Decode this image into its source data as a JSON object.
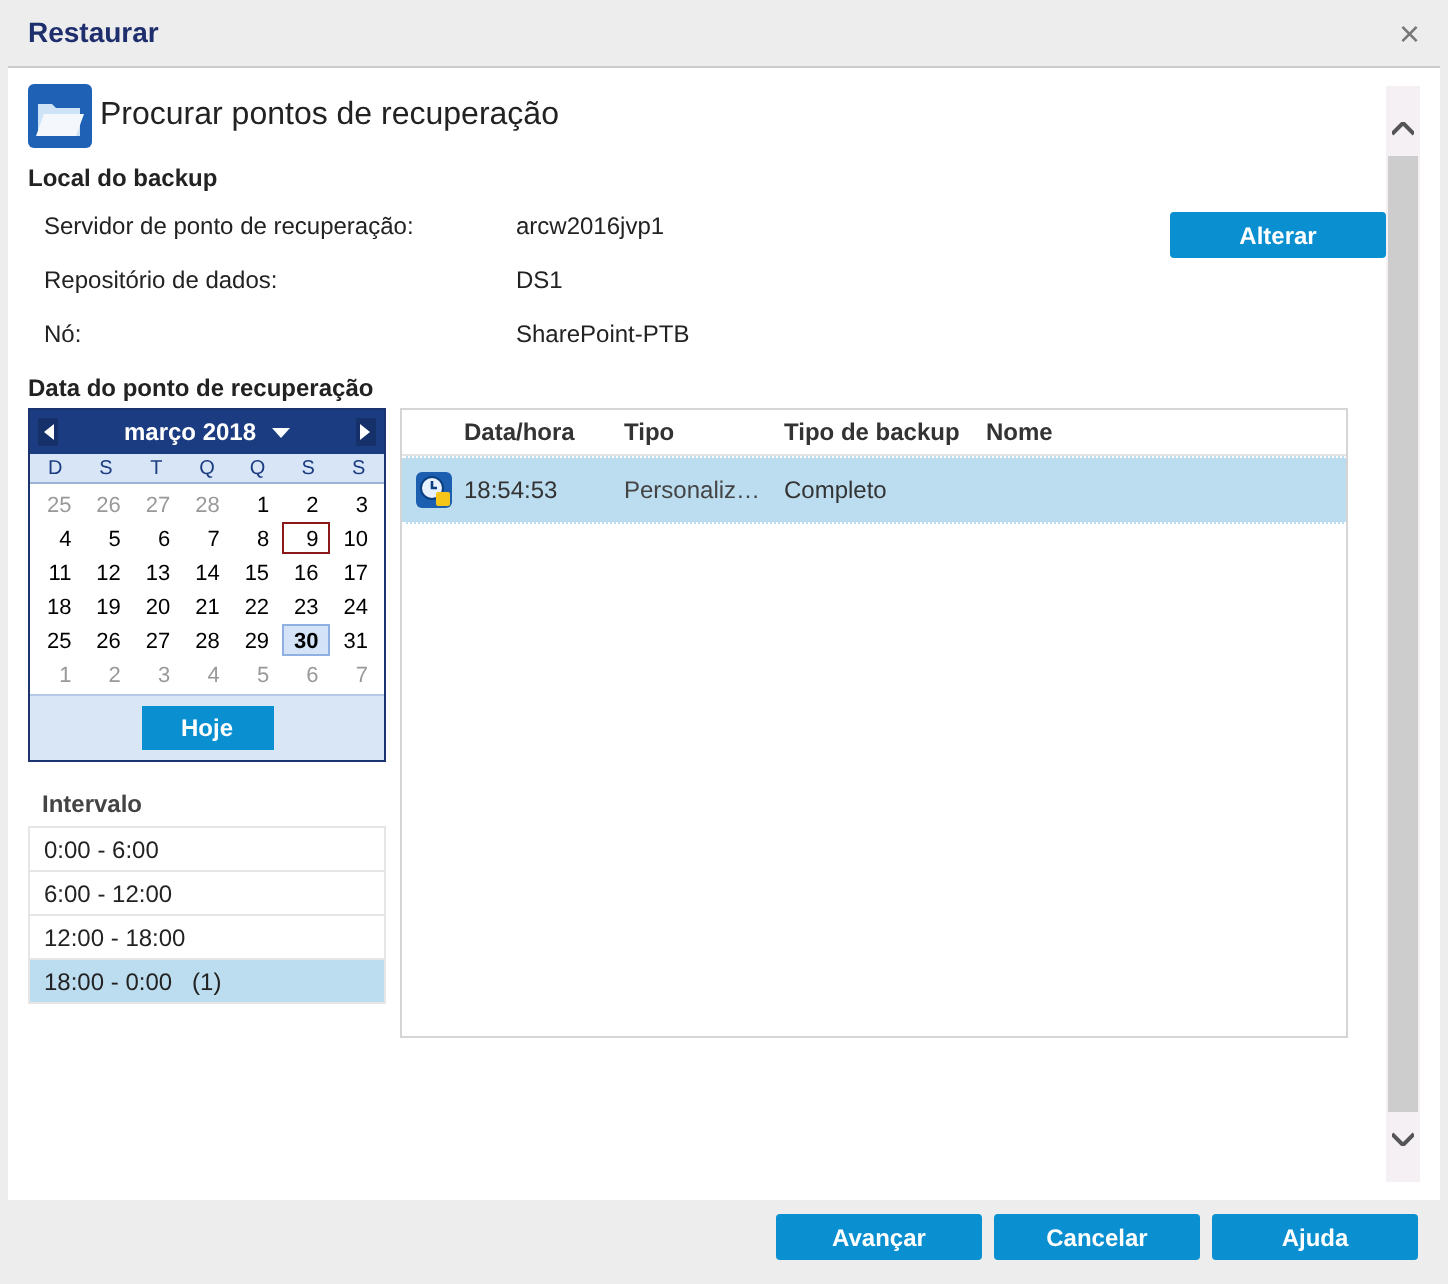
{
  "window": {
    "title": "Restaurar",
    "close": "×"
  },
  "header": {
    "title": "Procurar pontos de recuperação"
  },
  "backup_location": {
    "title": "Local do backup",
    "fields": [
      {
        "label": "Servidor de ponto de recuperação:",
        "value": "arcw2016jvp1"
      },
      {
        "label": "Repositório de dados:",
        "value": "DS1"
      },
      {
        "label": "Nó:",
        "value": "SharePoint-PTB"
      }
    ],
    "change_button": "Alterar"
  },
  "date_section": {
    "title": "Data do ponto de recuperação"
  },
  "calendar": {
    "month": "março 2018",
    "weekdays": [
      "D",
      "S",
      "T",
      "Q",
      "Q",
      "S",
      "S"
    ],
    "today_button": "Hoje",
    "days": [
      {
        "d": "25",
        "muted": true,
        "selected": false,
        "boxed": false
      },
      {
        "d": "26",
        "muted": true,
        "selected": false,
        "boxed": false
      },
      {
        "d": "27",
        "muted": true,
        "selected": false,
        "boxed": false
      },
      {
        "d": "28",
        "muted": true,
        "selected": false,
        "boxed": false
      },
      {
        "d": "1",
        "muted": false,
        "selected": false,
        "boxed": false
      },
      {
        "d": "2",
        "muted": false,
        "selected": false,
        "boxed": false
      },
      {
        "d": "3",
        "muted": false,
        "selected": false,
        "boxed": false
      },
      {
        "d": "4",
        "muted": false,
        "selected": false,
        "boxed": false
      },
      {
        "d": "5",
        "muted": false,
        "selected": false,
        "boxed": false
      },
      {
        "d": "6",
        "muted": false,
        "selected": false,
        "boxed": false
      },
      {
        "d": "7",
        "muted": false,
        "selected": false,
        "boxed": false
      },
      {
        "d": "8",
        "muted": false,
        "selected": false,
        "boxed": false
      },
      {
        "d": "9",
        "muted": false,
        "selected": false,
        "boxed": true
      },
      {
        "d": "10",
        "muted": false,
        "selected": false,
        "boxed": false
      },
      {
        "d": "11",
        "muted": false,
        "selected": false,
        "boxed": false
      },
      {
        "d": "12",
        "muted": false,
        "selected": false,
        "boxed": false
      },
      {
        "d": "13",
        "muted": false,
        "selected": false,
        "boxed": false
      },
      {
        "d": "14",
        "muted": false,
        "selected": false,
        "boxed": false
      },
      {
        "d": "15",
        "muted": false,
        "selected": false,
        "boxed": false
      },
      {
        "d": "16",
        "muted": false,
        "selected": false,
        "boxed": false
      },
      {
        "d": "17",
        "muted": false,
        "selected": false,
        "boxed": false
      },
      {
        "d": "18",
        "muted": false,
        "selected": false,
        "boxed": false
      },
      {
        "d": "19",
        "muted": false,
        "selected": false,
        "boxed": false
      },
      {
        "d": "20",
        "muted": false,
        "selected": false,
        "boxed": false
      },
      {
        "d": "21",
        "muted": false,
        "selected": false,
        "boxed": false
      },
      {
        "d": "22",
        "muted": false,
        "selected": false,
        "boxed": false
      },
      {
        "d": "23",
        "muted": false,
        "selected": false,
        "boxed": false
      },
      {
        "d": "24",
        "muted": false,
        "selected": false,
        "boxed": false
      },
      {
        "d": "25",
        "muted": false,
        "selected": false,
        "boxed": false
      },
      {
        "d": "26",
        "muted": false,
        "selected": false,
        "boxed": false
      },
      {
        "d": "27",
        "muted": false,
        "selected": false,
        "boxed": false
      },
      {
        "d": "28",
        "muted": false,
        "selected": false,
        "boxed": false
      },
      {
        "d": "29",
        "muted": false,
        "selected": false,
        "boxed": false
      },
      {
        "d": "30",
        "muted": false,
        "selected": true,
        "boxed": false
      },
      {
        "d": "31",
        "muted": false,
        "selected": false,
        "boxed": false
      },
      {
        "d": "1",
        "muted": true,
        "selected": false,
        "boxed": false
      },
      {
        "d": "2",
        "muted": true,
        "selected": false,
        "boxed": false
      },
      {
        "d": "3",
        "muted": true,
        "selected": false,
        "boxed": false
      },
      {
        "d": "4",
        "muted": true,
        "selected": false,
        "boxed": false
      },
      {
        "d": "5",
        "muted": true,
        "selected": false,
        "boxed": false
      },
      {
        "d": "6",
        "muted": true,
        "selected": false,
        "boxed": false
      },
      {
        "d": "7",
        "muted": true,
        "selected": false,
        "boxed": false
      }
    ]
  },
  "intervals": {
    "title": "Intervalo",
    "items": [
      {
        "label": "0:00 - 6:00",
        "selected": false
      },
      {
        "label": "6:00 - 12:00",
        "selected": false
      },
      {
        "label": "12:00 - 18:00",
        "selected": false
      },
      {
        "label": "18:00 - 0:00   (1)",
        "selected": true
      }
    ]
  },
  "table": {
    "columns": [
      "Data/hora",
      "Tipo",
      "Tipo de backup",
      "Nome"
    ],
    "rows": [
      {
        "time": "18:54:53",
        "type": "Personaliz…",
        "backup_type": "Completo",
        "selected": true
      }
    ]
  },
  "buttons": [
    "Avançar",
    "Cancelar",
    "Ajuda"
  ]
}
